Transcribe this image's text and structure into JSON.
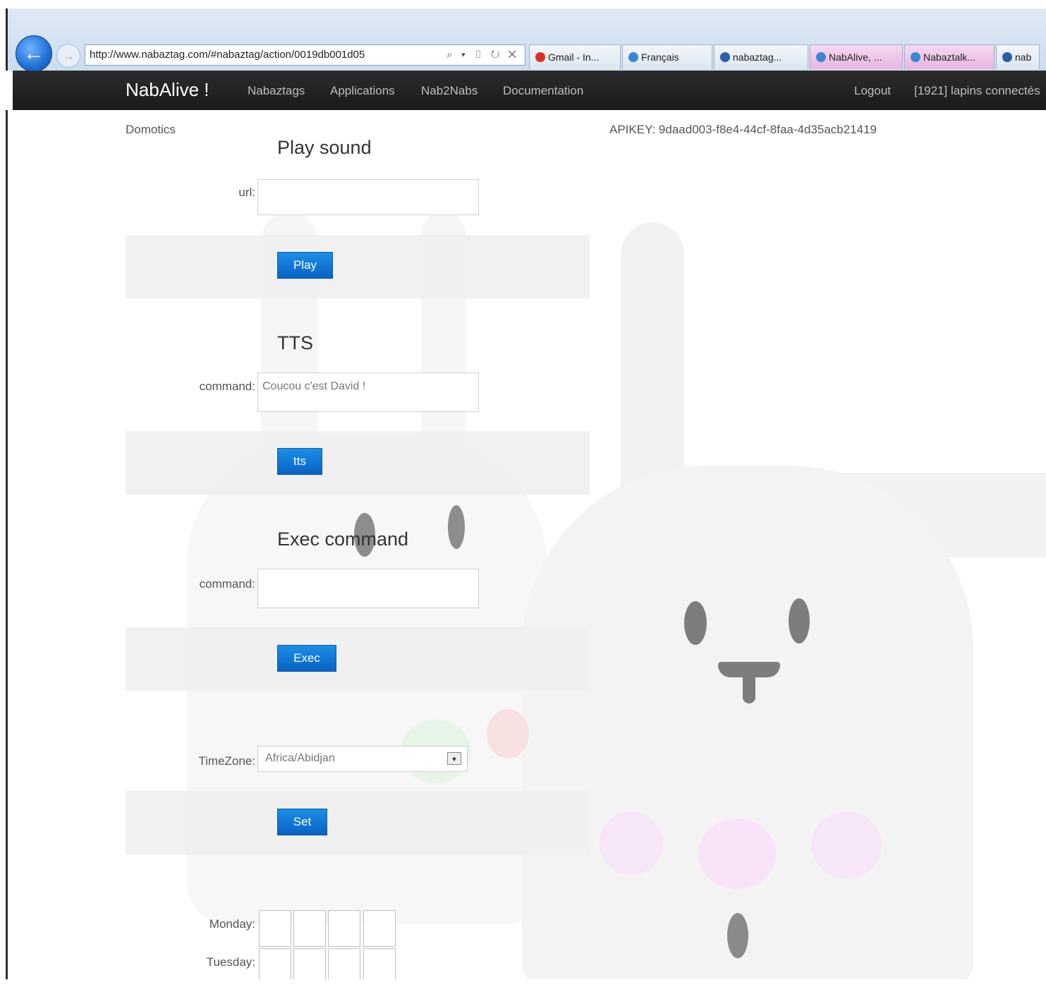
{
  "browser": {
    "address": "http://www.nabaztag.com/#nabaztag/action/0019db001d05",
    "address_controls": "⌕ ▾ ▯ ↻ ✕",
    "tabs": [
      {
        "label": "Gmail - In...",
        "color": "#d93025"
      },
      {
        "label": "Français",
        "color": "#3a86d6"
      },
      {
        "label": "nabaztag...",
        "color": "#2b5ea8"
      },
      {
        "label": "NabAlive, ...",
        "color": "#3a86d6"
      },
      {
        "label": "Nabaztalk...",
        "color": "#3a86d6"
      },
      {
        "label": "nab",
        "color": "#2b5ea8"
      }
    ]
  },
  "nav": {
    "brand": "NabAlive !",
    "links": [
      "Nabaztags",
      "Applications",
      "Nab2Nabs",
      "Documentation"
    ],
    "logout": "Logout",
    "connected": "[1921] lapins connectés"
  },
  "page": {
    "breadcrumb": "Domotics",
    "apikey": "APIKEY: 9daad003-f8e4-44cf-8faa-4d35acb21419"
  },
  "play_sound": {
    "title": "Play sound",
    "url_label": "url:",
    "url_value": "",
    "button": "Play"
  },
  "tts": {
    "title": "TTS",
    "command_label": "command:",
    "command_value": "Coucou c'est David !",
    "button": "tts"
  },
  "exec": {
    "title": "Exec command",
    "command_label": "command:",
    "command_value": "",
    "button": "Exec"
  },
  "timezone": {
    "label": "TimeZone:",
    "selected": "Africa/Abidjan",
    "button": "Set"
  },
  "schedule": {
    "days": [
      "Monday:",
      "Tuesday:"
    ]
  }
}
